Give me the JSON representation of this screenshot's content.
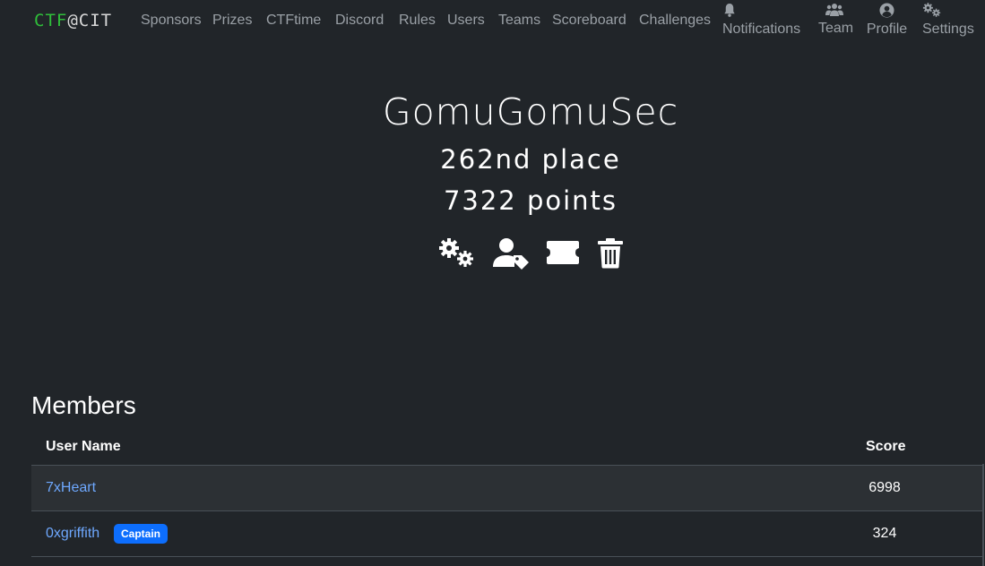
{
  "navbar": {
    "brand_prefix": "CTF",
    "brand_suffix": "@CIT",
    "links": [
      "Sponsors",
      "Prizes",
      "CTFtime",
      "Discord",
      "Rules",
      "Users",
      "Teams",
      "Scoreboard",
      "Challenges"
    ],
    "icon_links": {
      "notifications": {
        "label": "Notifications",
        "icon": "bell-icon"
      },
      "team": {
        "label": "Team",
        "icon": "users-icon"
      },
      "profile": {
        "label": "Profile",
        "icon": "user-circle-icon"
      },
      "settings": {
        "label": "Settings",
        "icon": "cogs-icon"
      }
    }
  },
  "team": {
    "name": "GomuGomuSec",
    "place": "262nd place",
    "points": "7322 points",
    "actions": [
      {
        "name": "team-settings",
        "icon": "cogs-icon"
      },
      {
        "name": "transfer-captain",
        "icon": "user-tag-icon"
      },
      {
        "name": "team-invite",
        "icon": "ticket-icon"
      },
      {
        "name": "disband-team",
        "icon": "trash-icon"
      }
    ]
  },
  "members": {
    "heading": "Members",
    "columns": {
      "user": "User Name",
      "score": "Score"
    },
    "rows": [
      {
        "name": "7xHeart",
        "score": "6998",
        "badge": ""
      },
      {
        "name": "0xgriffith",
        "score": "324",
        "badge": "Captain"
      }
    ]
  },
  "colors": {
    "background": "#212529",
    "link": "#6ea8fe",
    "badge": "#0d6efd",
    "brand_green": "#2fbf3a",
    "nav_text": "#9aa0a6"
  }
}
